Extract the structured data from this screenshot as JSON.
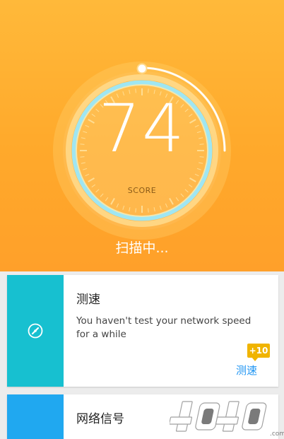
{
  "hero": {
    "score": "74",
    "score_label": "SCORE",
    "scan_status": "扫描中...",
    "background_color": "#ffa92b"
  },
  "cards": [
    {
      "title": "测速",
      "description": "You haven't test your network speed for a while",
      "badge": "+10",
      "action_label": "测速",
      "icon": "speed-gauge-icon",
      "accent_color": "#17c0d0"
    },
    {
      "title": "网络信号",
      "icon": "signal-icon",
      "accent_color": "#20a8f0"
    }
  ],
  "watermark": {
    "text": "4O4O.com"
  }
}
